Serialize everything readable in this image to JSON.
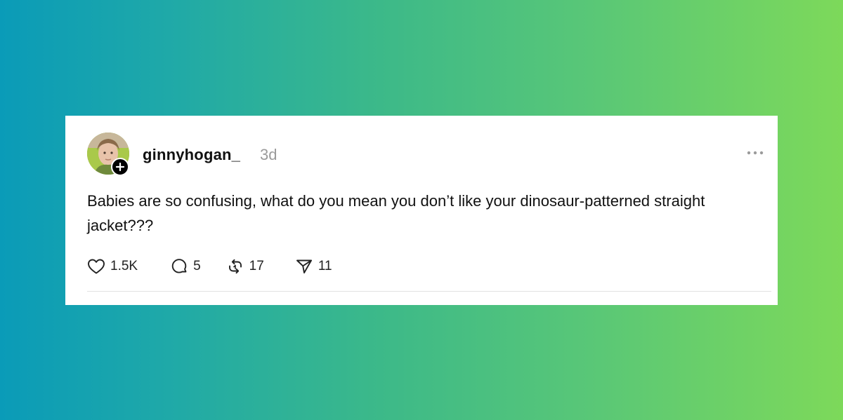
{
  "post": {
    "username": "ginnyhogan_",
    "timestamp": "3d",
    "text": "Babies are so confusing, what do you mean you don’t like your dinosaur-patterned straight jacket???",
    "more_icon": "ellipsis-icon",
    "avatar_badge_icon": "plus-icon"
  },
  "actions": {
    "likes": "1.5K",
    "replies": "5",
    "reposts": "17",
    "shares": "11"
  },
  "colors": {
    "gradient_start": "#0a9bb8",
    "gradient_end": "#7dd95a",
    "card_background": "#ffffff",
    "timestamp": "#9b9b9b"
  }
}
